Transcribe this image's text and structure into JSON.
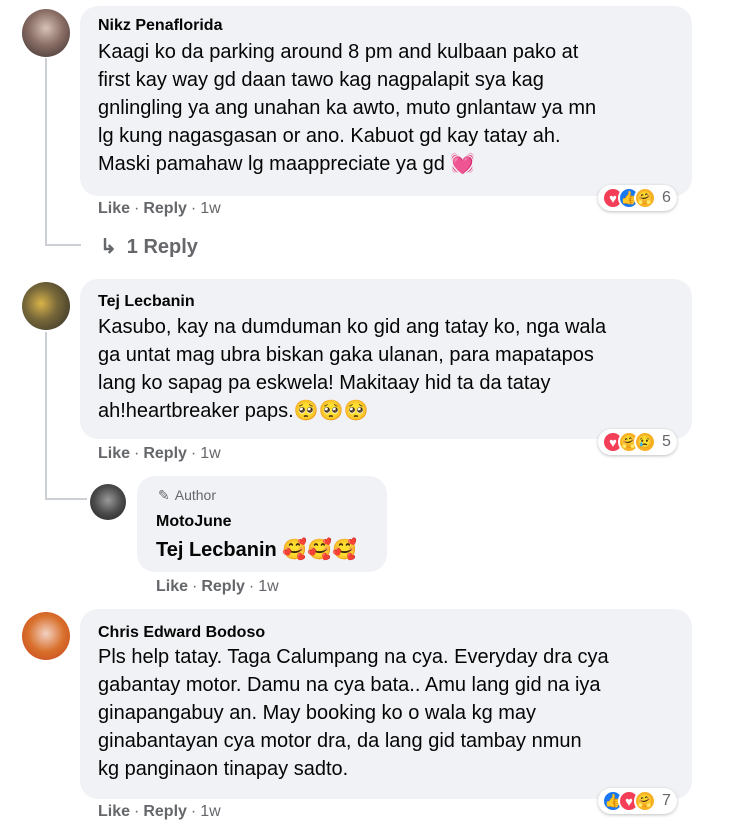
{
  "comments": [
    {
      "author": "Nikz Penaflorida",
      "text": "Kaagi ko da parking around 8 pm and kulbaan pako at\nfirst kay way gd daan tawo kag nagpalapit sya kag\ngnlingling ya ang unahan ka awto, muto gnlantaw ya mn\nlg kung nagasgasan or ano. Kabuot gd kay tatay ah.\nMaski pamahaw lg maappreciate ya gd",
      "text_emoji": "💓",
      "like": "Like",
      "reply": "Reply",
      "time": "1w",
      "reaction_count": "6",
      "reactions": [
        "love",
        "like",
        "care"
      ]
    },
    {
      "author": "Tej Lecbanin",
      "text": "Kasubo, kay na dumduman ko gid ang tatay ko, nga wala\nga untat mag ubra biskan gaka ulanan, para mapatapos\nlang ko sapag pa eskwela! Makitaay hid ta da tatay\nah!heartbreaker paps.",
      "text_emoji": "🥺🥺🥺",
      "like": "Like",
      "reply": "Reply",
      "time": "1w",
      "reaction_count": "5",
      "reactions": [
        "love",
        "care",
        "sad"
      ]
    },
    {
      "author": "Chris Edward Bodoso",
      "text": "Pls help tatay. Taga Calumpang na cya. Everyday dra cya\ngabantay motor. Damu na cya bata.. Amu lang gid na iya\nginapangabuy an. May booking ko o wala kg may\nginabantayan cya motor dra, da lang gid tambay nmun\nkg panginaon tinapay sadto.",
      "like": "Like",
      "reply": "Reply",
      "time": "1w",
      "reaction_count": "7",
      "reactions": [
        "like",
        "love",
        "care"
      ]
    }
  ],
  "replies_link": "1 Reply",
  "reply_arrow": "↳",
  "author_reply": {
    "badge_icon": "pencil-icon",
    "badge_label": "Author",
    "author": "MotoJune",
    "text": "Tej Lecbanin",
    "text_emoji": "🥰🥰🥰",
    "like": "Like",
    "reply": "Reply",
    "time": "1w"
  },
  "separator": "·",
  "reaction_glyphs": {
    "love": "♥",
    "like": "👍",
    "care": "🤗",
    "sad": "😢"
  },
  "colors": {
    "bubble": "#f0f2f5",
    "meta_text": "#65676b",
    "like_blue": "#1877f2",
    "love_red": "#f33e58",
    "care_yellow": "#f7b125"
  }
}
